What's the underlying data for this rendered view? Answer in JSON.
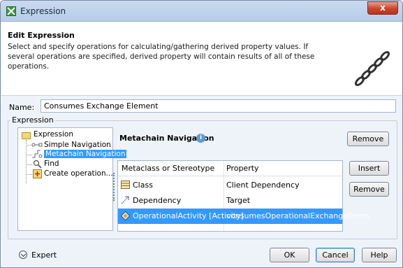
{
  "window": {
    "title": "Expression",
    "close_glyph": "x"
  },
  "header": {
    "title": "Edit Expression",
    "description": "Select and specify operations for calculating/gathering derived property values. If several operations are specified, derived property will contain results of all of these operations.",
    "icon": "chain-icon"
  },
  "name_field": {
    "label": "Name:",
    "value": "Consumes Exchange Element"
  },
  "expression_group": {
    "label": "Expression"
  },
  "tree": {
    "root": "Expression",
    "items": [
      {
        "label": "Simple Navigation",
        "icon": "navigation-icon"
      },
      {
        "label": "Metachain Navigation",
        "icon": "metachain-icon",
        "selected": true
      },
      {
        "label": "Find",
        "icon": "find-icon"
      },
      {
        "label": "Create operation...",
        "icon": "plus-icon"
      }
    ]
  },
  "detail": {
    "title": "Metachain Navigation",
    "info_icon": "info-icon",
    "remove_label": "Remove",
    "insert_label": "Insert",
    "remove_row_label": "Remove",
    "columns": [
      "Metaclass or Stereotype",
      "Property"
    ],
    "rows": [
      {
        "metaclass": "Class",
        "property": "Client Dependency",
        "icon": "class-icon"
      },
      {
        "metaclass": "Dependency",
        "property": "Target",
        "icon": "dependency-icon"
      },
      {
        "metaclass": "OperationalActivity [Activity]",
        "property": "consumesOperationalExchangeItems",
        "icon": "activity-icon",
        "selected": true
      }
    ]
  },
  "footer": {
    "expert_label": "Expert",
    "ok_label": "OK",
    "cancel_label": "Cancel",
    "help_label": "Help"
  }
}
